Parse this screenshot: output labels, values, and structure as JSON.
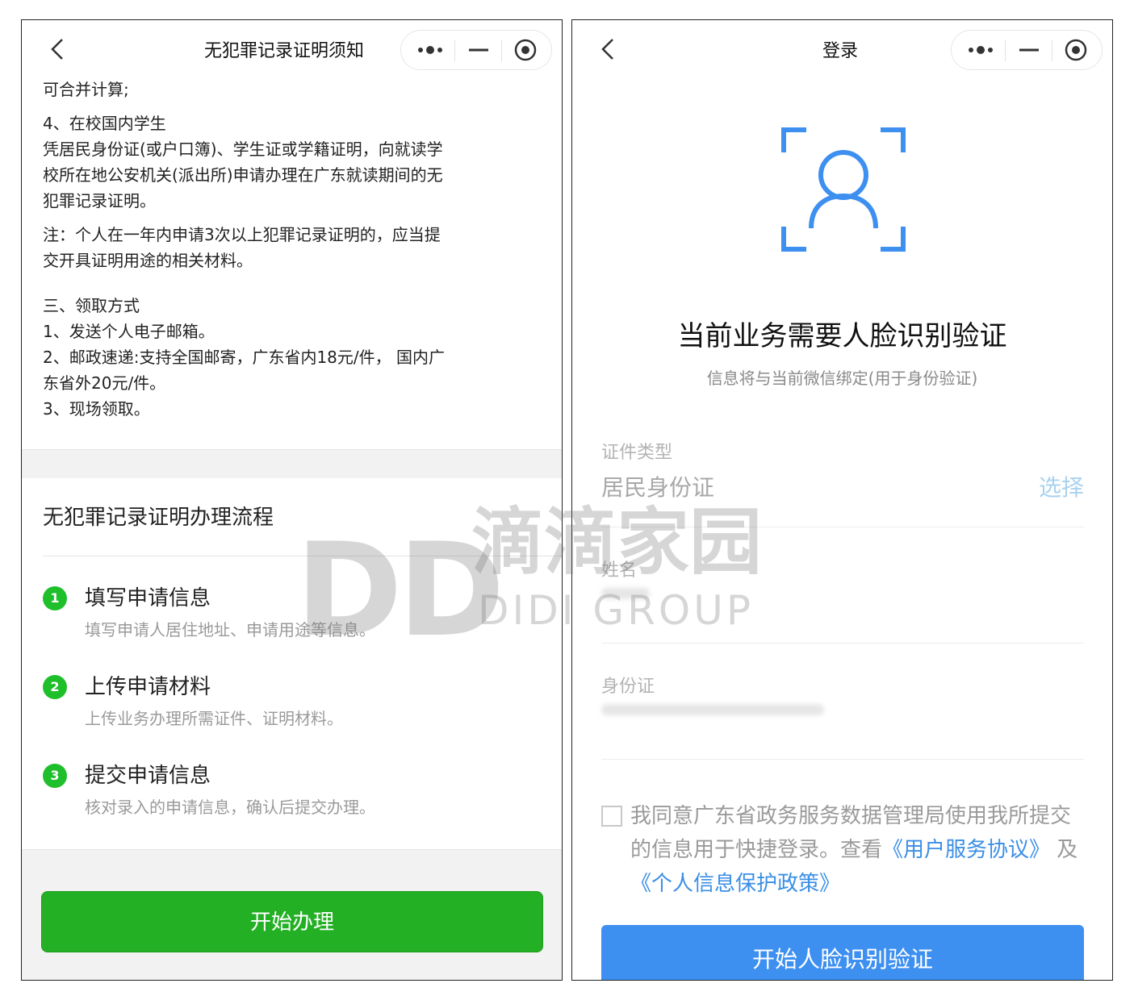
{
  "left": {
    "nav_title": "无犯罪记录证明须知",
    "notice": [
      "可合并计算;",
      "4、在校国内学生",
      "凭居民身份证(或户口簿)、学生证或学籍证明，向就读学",
      "校所在地公安机关(派出所)申请办理在广东就读期间的无",
      "犯罪记录证明。",
      "注：个人在一年内申请3次以上犯罪记录证明的，应当提",
      "交开具证明用途的相关材料。",
      "三、领取方式",
      "1、发送个人电子邮箱。",
      "2、邮政速递:支持全国邮寄，广东省内18元/件， 国内广",
      "东省外20元/件。",
      "3、现场领取。"
    ],
    "flow_title": "无犯罪记录证明办理流程",
    "steps": [
      {
        "num": "1",
        "title": "填写申请信息",
        "desc": "填写申请人居住地址、申请用途等信息。"
      },
      {
        "num": "2",
        "title": "上传申请材料",
        "desc": "上传业务办理所需证件、证明材料。"
      },
      {
        "num": "3",
        "title": "提交申请信息",
        "desc": "核对录入的申请信息，确认后提交办理。"
      }
    ],
    "start_button": "开始办理"
  },
  "right": {
    "nav_title": "登录",
    "heading": "当前业务需要人脸识别验证",
    "subheading": "信息将与当前微信绑定(用于身份验证)",
    "fields": {
      "type_label": "证件类型",
      "type_value": "居民身份证",
      "type_select": "选择",
      "name_label": "姓名",
      "id_label": "身份证"
    },
    "agree": {
      "text": "我同意广东省政务服务数据管理局使用我所提交的信息用于快捷登录。查看",
      "link1": "《用户服务协议》",
      "and": "及",
      "link2": "《个人信息保护政策》"
    },
    "face_button": "开始人脸识别验证"
  },
  "watermark": {
    "logo": "DD",
    "cn": "滴滴家园",
    "en": "DIDI GROUP"
  },
  "colors": {
    "green_button": "#24b024",
    "step_badge": "#1fbf2c",
    "blue_button": "#3d8ff0",
    "face_icon": "#3d8ff0",
    "link": "#3a8ee6"
  },
  "icons": [
    "back-chevron-icon",
    "more-dots-icon",
    "minimize-icon",
    "target-icon",
    "face-scan-icon"
  ]
}
